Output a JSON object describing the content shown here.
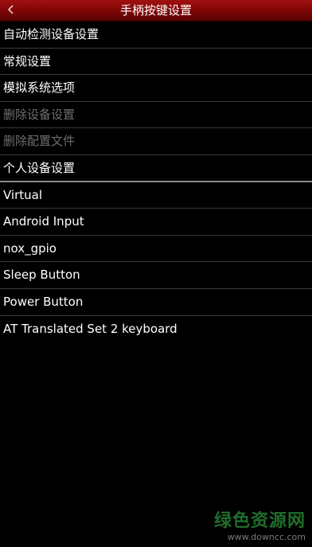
{
  "header": {
    "title": "手柄按键设置",
    "back_icon": "chevron-left-icon"
  },
  "menu": {
    "items": [
      {
        "label": "自动检测设备设置",
        "enabled": true
      },
      {
        "label": "常规设置",
        "enabled": true
      },
      {
        "label": "模拟系统选项",
        "enabled": true
      },
      {
        "label": "删除设备设置",
        "enabled": false
      },
      {
        "label": "删除配置文件",
        "enabled": false
      },
      {
        "label": "个人设备设置",
        "enabled": true
      }
    ]
  },
  "devices": {
    "items": [
      {
        "label": "Virtual"
      },
      {
        "label": "Android Input"
      },
      {
        "label": "nox_gpio"
      },
      {
        "label": "Sleep Button"
      },
      {
        "label": "Power Button"
      },
      {
        "label": "AT Translated Set 2 keyboard"
      }
    ]
  },
  "watermark": {
    "logo": "绿色资源网",
    "url": "www.downcc.com"
  },
  "colors": {
    "header": "#8b0a0a",
    "background": "#000000",
    "disabled_text": "#6e6e6e",
    "watermark_green": "#1f6e2b"
  }
}
